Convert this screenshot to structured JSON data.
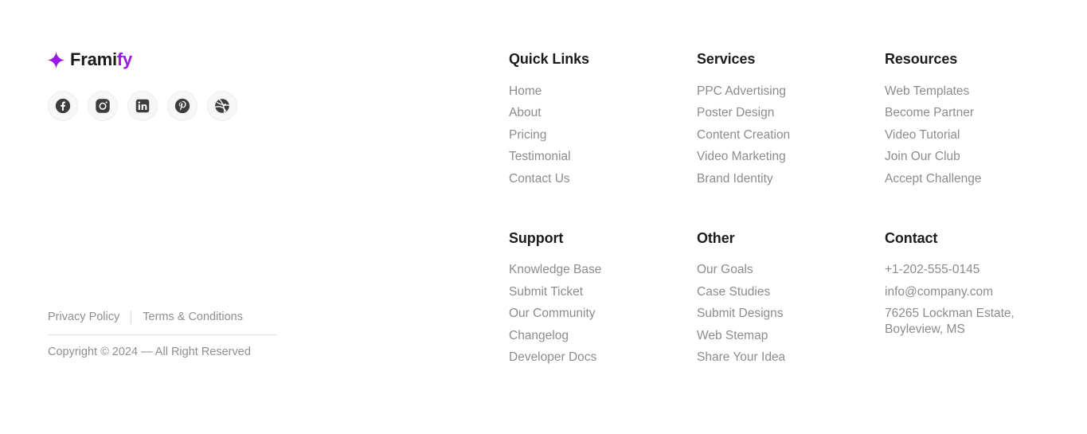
{
  "brand": {
    "name_dark": "Frami",
    "name_accent": "fy",
    "accent_color": "#9b18e8",
    "logo_icon": "sparkle-star-icon",
    "socials": [
      {
        "name": "facebook",
        "label": "Facebook"
      },
      {
        "name": "instagram",
        "label": "Instagram"
      },
      {
        "name": "linkedin",
        "label": "LinkedIn"
      },
      {
        "name": "pinterest",
        "label": "Pinterest"
      },
      {
        "name": "dribbble",
        "label": "Dribbble"
      }
    ]
  },
  "legal": {
    "privacy": "Privacy Policy",
    "terms": "Terms & Conditions",
    "copyright": "Copyright © 2024 — All Right Reserved"
  },
  "columns": {
    "quick_links": {
      "title": "Quick Links",
      "items": [
        "Home",
        "About",
        "Pricing",
        "Testimonial",
        "Contact Us"
      ]
    },
    "services": {
      "title": "Services",
      "items": [
        "PPC Advertising",
        "Poster Design",
        "Content Creation",
        "Video Marketing",
        "Brand Identity"
      ]
    },
    "resources": {
      "title": "Resources",
      "items": [
        "Web Templates",
        "Become Partner",
        "Video Tutorial",
        "Join Our Club",
        "Accept Challenge"
      ]
    },
    "support": {
      "title": "Support",
      "items": [
        "Knowledge Base",
        "Submit Ticket",
        "Our Community",
        "Changelog",
        "Developer Docs"
      ]
    },
    "other": {
      "title": "Other",
      "items": [
        "Our Goals",
        "Case Studies",
        "Submit Designs",
        "Web Stemap",
        "Share Your Idea"
      ]
    },
    "contact": {
      "title": "Contact",
      "items": [
        "+1-202-555-0145",
        "info@company.com",
        "76265 Lockman Estate, Boyleview, MS"
      ]
    }
  },
  "colors": {
    "background": "#ffffff",
    "heading": "#1c1c1c",
    "link": "#8c8c8c",
    "muted": "#8f8f8f",
    "rule": "#e3e3e3",
    "social_bg": "#f7f7f7",
    "icon_dark": "#3d3d3d"
  }
}
